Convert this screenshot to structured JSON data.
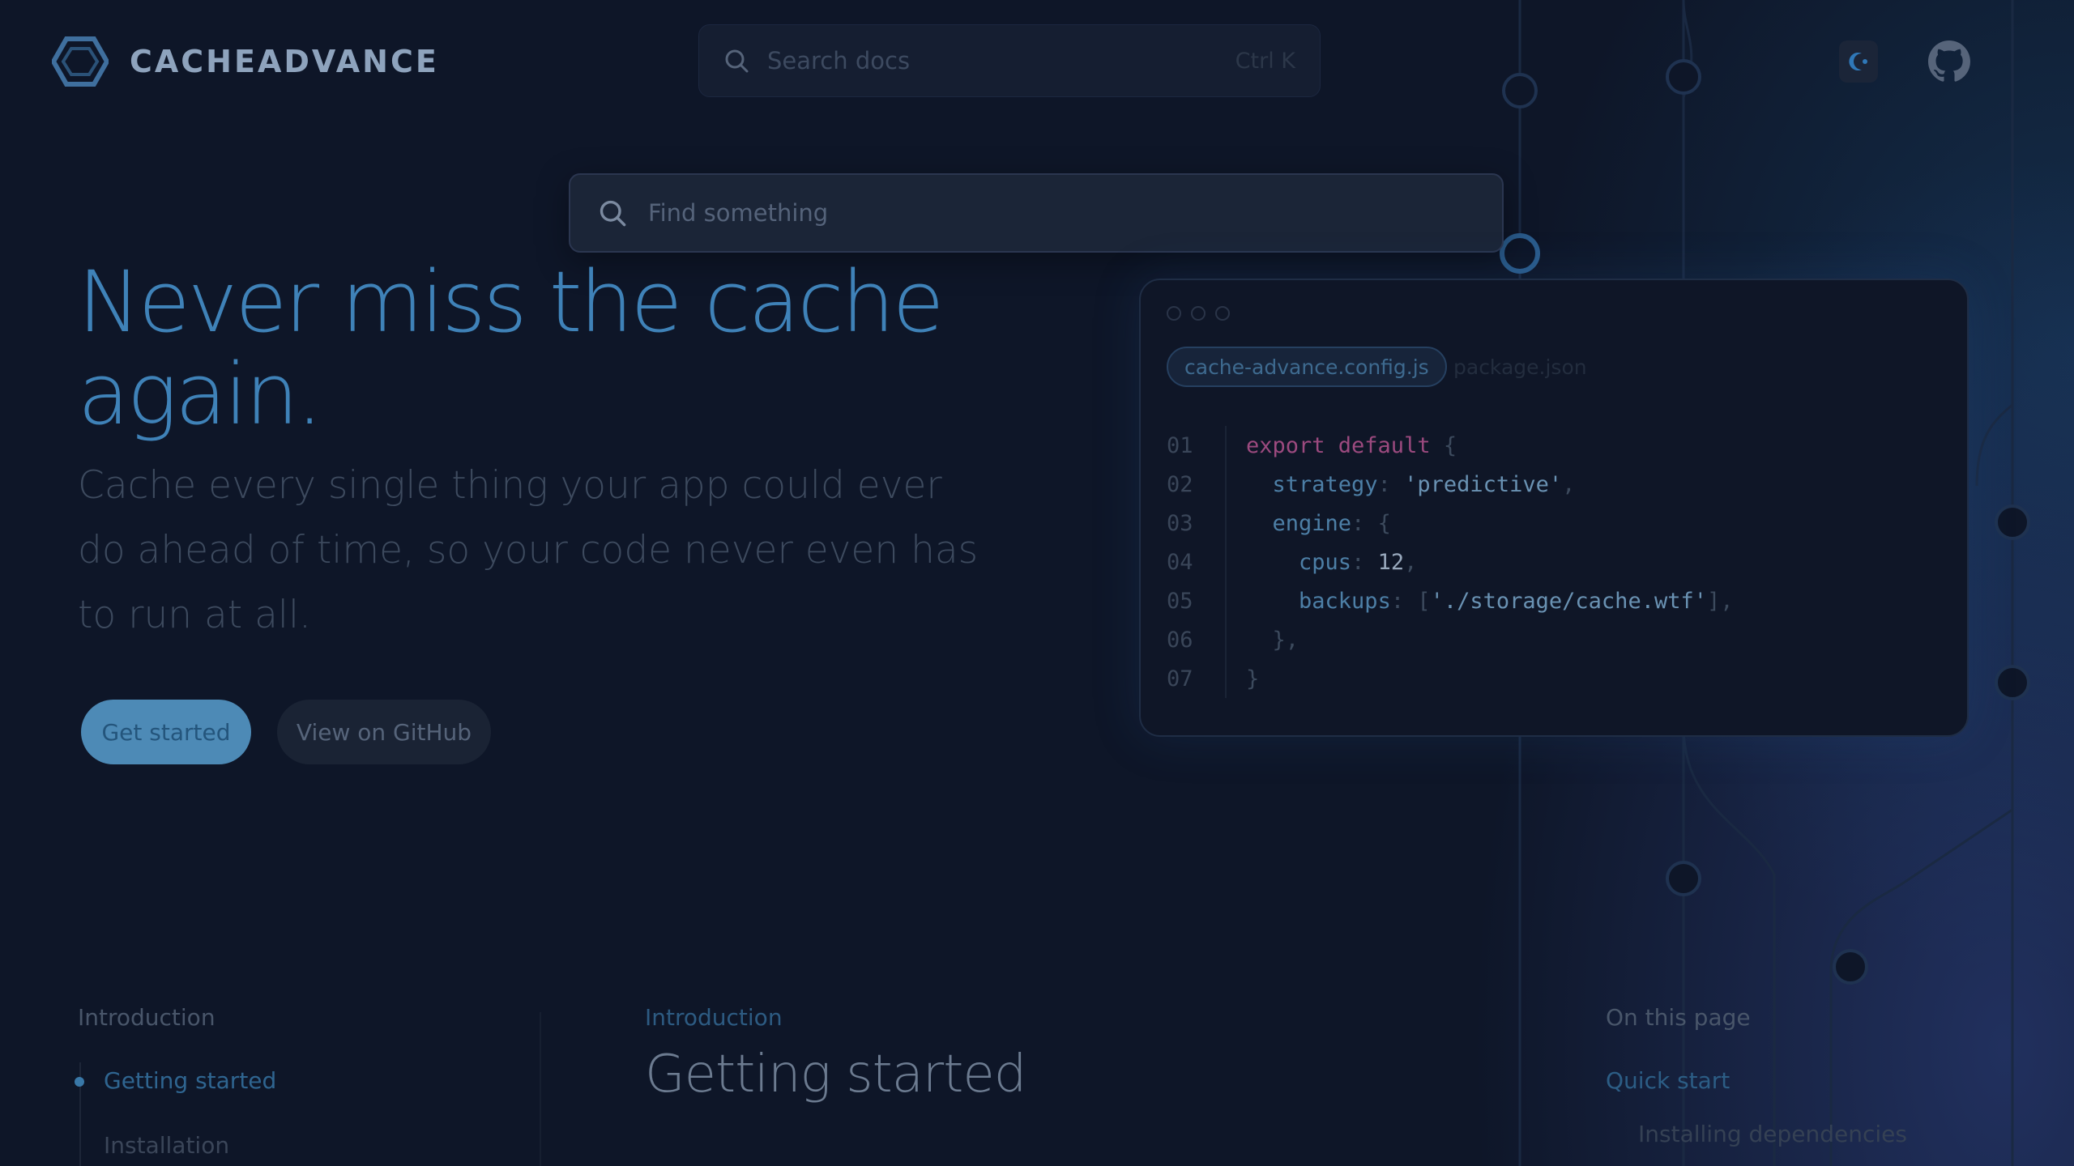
{
  "header": {
    "brand": "CACHEADVANCE",
    "search_placeholder": "Search docs",
    "search_shortcut": "Ctrl K"
  },
  "overlay": {
    "find_placeholder": "Find something"
  },
  "hero": {
    "title_line1": "Never miss the cache",
    "title_line2": "again.",
    "subtitle": "Cache every single thing your app could ever do ahead of time, so your code never even has to run at all.",
    "primary_button": "Get started",
    "secondary_button": "View on GitHub"
  },
  "code_card": {
    "tabs": [
      "cache-advance.config.js",
      "package.json"
    ],
    "line_numbers": [
      "01",
      "02",
      "03",
      "04",
      "05",
      "06",
      "07"
    ],
    "lines": {
      "l1_kw": "export default",
      "l1_brace": "{",
      "l2_prop": "strategy",
      "l2_val": "'predictive'",
      "l3_prop": "engine",
      "l3_brace": "{",
      "l4_prop": "cpus",
      "l4_val": "12",
      "l5_prop": "backups",
      "l5_val": "'./storage/cache.wtf'",
      "l6_close": "},",
      "l7_close": "}"
    }
  },
  "sidebar": {
    "section": "Introduction",
    "items": [
      "Getting started",
      "Installation"
    ]
  },
  "content": {
    "eyebrow": "Introduction",
    "title": "Getting started"
  },
  "toc": {
    "title": "On this page",
    "items": [
      "Quick start",
      "Installing dependencies"
    ]
  },
  "colors": {
    "accent": "#3f82b8",
    "background": "#0e1628",
    "keyword": "#9c4a7f"
  },
  "icons": [
    "logo-hexagon-icon",
    "search-icon",
    "theme-toggle-icon",
    "github-icon"
  ]
}
